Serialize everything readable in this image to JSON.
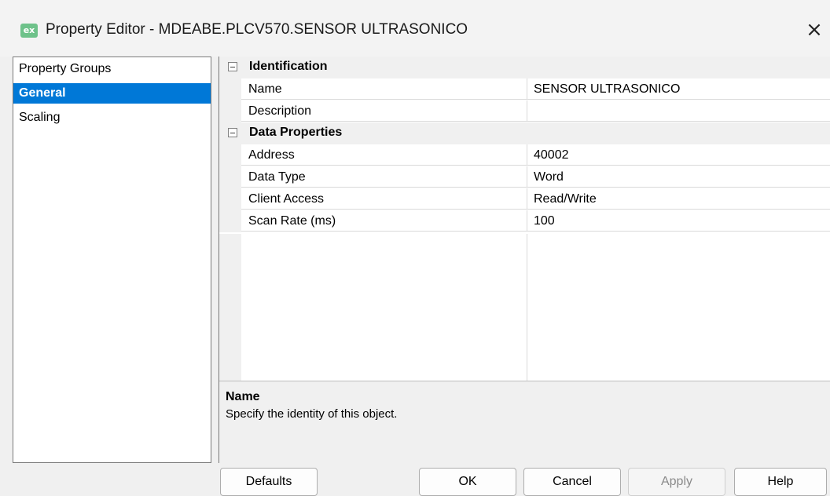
{
  "window": {
    "app_icon_text": "ex",
    "title": "Property Editor - MDEABE.PLCV570.SENSOR ULTRASONICO",
    "close_glyph": "×"
  },
  "left_panel": {
    "items": [
      {
        "label": "Property Groups",
        "selected": false
      },
      {
        "label": "General",
        "selected": true
      },
      {
        "label": "Scaling",
        "selected": false
      }
    ]
  },
  "property_grid": {
    "categories": [
      {
        "label": "Identification",
        "expanded": true,
        "properties": [
          {
            "name": "Name",
            "value": "SENSOR ULTRASONICO"
          },
          {
            "name": "Description",
            "value": ""
          }
        ]
      },
      {
        "label": "Data Properties",
        "expanded": true,
        "properties": [
          {
            "name": "Address",
            "value": "40002"
          },
          {
            "name": "Data Type",
            "value": "Word"
          },
          {
            "name": "Client Access",
            "value": "Read/Write"
          },
          {
            "name": "Scan Rate (ms)",
            "value": "100"
          }
        ]
      }
    ]
  },
  "description_pane": {
    "title": "Name",
    "text": "Specify the identity of this object."
  },
  "buttons": {
    "defaults": "Defaults",
    "ok": "OK",
    "cancel": "Cancel",
    "apply": "Apply",
    "help": "Help"
  },
  "colors": {
    "selection": "#0078d7",
    "app_icon": "#6ec28a"
  }
}
